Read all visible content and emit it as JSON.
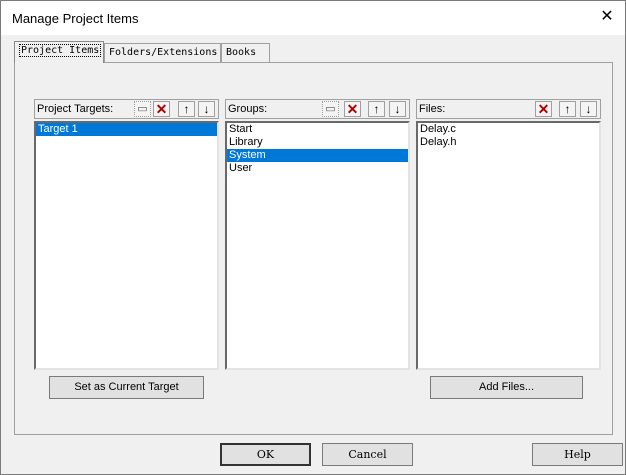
{
  "window": {
    "title": "Manage Project Items"
  },
  "tabs": [
    {
      "label": "Project Items"
    },
    {
      "label": "Folders/Extensions"
    },
    {
      "label": "Books"
    }
  ],
  "targets": {
    "label": "Project Targets:",
    "items": [
      "Target 1"
    ],
    "selected_index": 0
  },
  "groups": {
    "label": "Groups:",
    "items": [
      "Start",
      "Library",
      "System",
      "User"
    ],
    "selected_index": 2
  },
  "files": {
    "label": "Files:",
    "items": [
      "Delay.c",
      "Delay.h"
    ]
  },
  "buttons": {
    "set_current": "Set as Current Target",
    "add_files": "Add Files...",
    "ok": "OK",
    "cancel": "Cancel",
    "help": "Help"
  },
  "colors": {
    "selection": "#0078d7",
    "delete": "#b00000"
  }
}
